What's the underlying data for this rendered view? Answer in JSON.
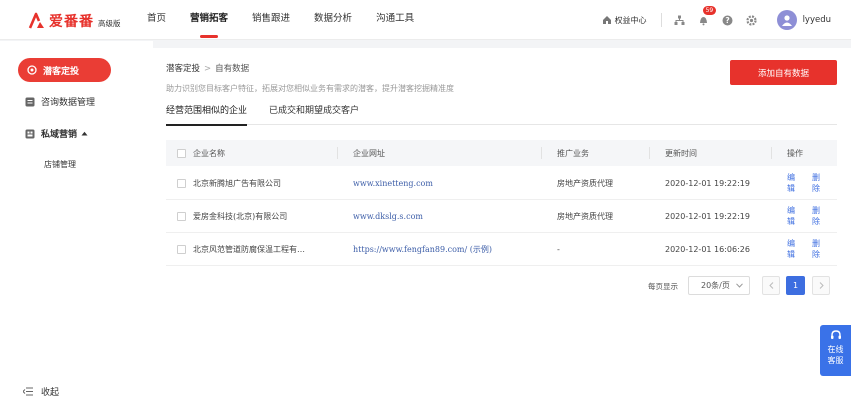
{
  "brand": {
    "name": "爱番番",
    "edition": "高级版"
  },
  "nav": [
    {
      "label": "首页",
      "active": false
    },
    {
      "label": "营销拓客",
      "active": true
    },
    {
      "label": "销售跟进",
      "active": false
    },
    {
      "label": "数据分析",
      "active": false
    },
    {
      "label": "沟通工具",
      "active": false
    }
  ],
  "header": {
    "rights_label": "权益中心",
    "notification_count": "59",
    "username": "lyyedu"
  },
  "sidebar": {
    "items": [
      {
        "label": "潜客定投",
        "icon": "target-icon",
        "active": true
      },
      {
        "label": "咨询数据管理",
        "icon": "data-manage-icon",
        "active": false
      },
      {
        "label": "私域营销",
        "icon": "private-domain-icon",
        "active": false,
        "expanded": true
      }
    ],
    "sub_items": [
      {
        "label": "店铺管理"
      }
    ],
    "collapse_label": "收起"
  },
  "main": {
    "breadcrumb": {
      "parent": "潜客定投",
      "current": "自有数据"
    },
    "description": "助力识别您目标客户特征，拓展对您相似业务有需求的潜客，提升潜客挖掘精准度",
    "add_button": "添加自有数据",
    "tabs": [
      {
        "label": "经营范围相似的企业",
        "active": true
      },
      {
        "label": "已成交和期望成交客户",
        "active": false
      }
    ],
    "table": {
      "columns": [
        "企业名称",
        "企业网址",
        "推广业务",
        "更新时间",
        "操作"
      ],
      "rows": [
        {
          "company": "北京新腾旭广告有限公司",
          "url": "www.xinetteng.com",
          "business": "房地产资质代理",
          "updated": "2020-12-01 19:22:19",
          "edit": "编辑",
          "delete": "删除"
        },
        {
          "company": "爱房金科技(北京)有限公司",
          "url": "www.dkslg.s.com",
          "business": "房地产资质代理",
          "updated": "2020-12-01 19:22:19",
          "edit": "编辑",
          "delete": "删除"
        },
        {
          "company": "北京风范管道防腐保温工程有…",
          "url": "https://www.fengfan89.com/ (示例)",
          "business": "-",
          "updated": "2020-12-01 16:06:26",
          "edit": "编辑",
          "delete": "删除"
        }
      ]
    },
    "pagination": {
      "per_page_label": "每页显示",
      "per_page_value": "20条/页",
      "current_page": "1"
    }
  },
  "service": {
    "line1": "在线",
    "line2": "客服"
  },
  "colors": {
    "brand_red": "#e7322c",
    "link_blue": "#3d6ee0",
    "service_blue": "#3a72e8"
  }
}
